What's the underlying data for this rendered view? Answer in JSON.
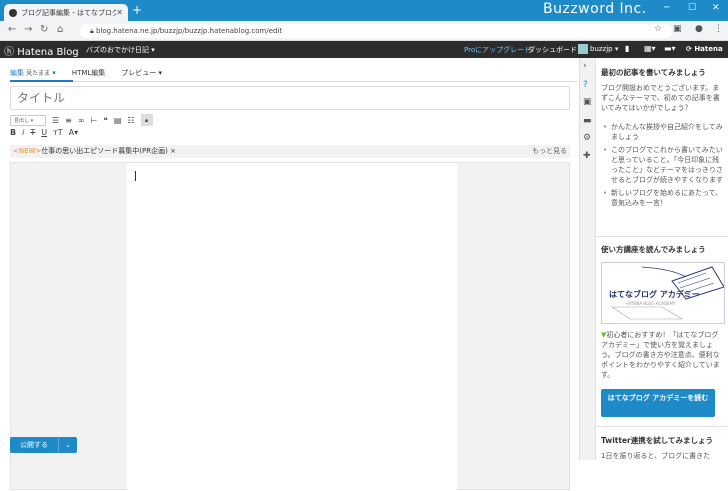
{
  "browser": {
    "tab_title": "ブログ記事編集 - はてなブログ",
    "new_tab": "+",
    "brand": "Buzzword Inc.",
    "url": "blog.hatena.ne.jp/buzzjp/buzzjp.hatenablog.com/edit"
  },
  "hatena": {
    "logo": "Hatena Blog",
    "blog_name": "バズのおでかけ日記",
    "pro_upgrade": "Proにアップグレード",
    "dashboard": "ダッシュボード",
    "user": "buzzjp",
    "right_logo": "Hatena"
  },
  "editor": {
    "tabs": [
      {
        "label": "編集",
        "sub": "見たまま"
      },
      {
        "label": "HTML編集"
      },
      {
        "label": "プレビュー"
      }
    ],
    "title_placeholder": "タイトル",
    "heading_select": "見出し",
    "banner_tag": "<NEW>",
    "banner_text": "仕事の思い出エピソード募集中(PR企画)",
    "banner_close": "×",
    "banner_more": "もっと見る",
    "publish": "公開する",
    "colors": {
      "accent": "#1f8ac8",
      "new_tag": "#e58e26"
    }
  },
  "sidebar": {
    "section1_title": "最初の記事を書いてみましょう",
    "section1_intro": "ブログ開設おめでとうございます。まずこんなテーマで、初めての記事を書いてみてはいかがでしょう？",
    "tips": [
      "かんたんな挨拶や自己紹介をしてみましょう",
      "このブログでこれから書いてみたいと思っていること。「今日印象に残ったこと」などテーマをはっきりさせるとブログが続きやすくなります",
      "新しいブログを始めるにあたって、意気込みを一言！"
    ],
    "section2_title": "使い方講座を読んでみましょう",
    "banner_title": "はてなブログ アカデミー",
    "banner_sub": "HATENA BLOG ACADEMY",
    "section2_text": "初心者におすすめ！「はてなブログ アカデミー」で使い方を覚えましょう。ブログの書き方や注意点、便利なポイントをわかりやすく紹介しています。",
    "cta": "はてなブログ アカデミーを読む",
    "section3_title": "Twitter連携を試してみましょう",
    "section3_text": "1日を振り返ると、ブログに書きた"
  }
}
